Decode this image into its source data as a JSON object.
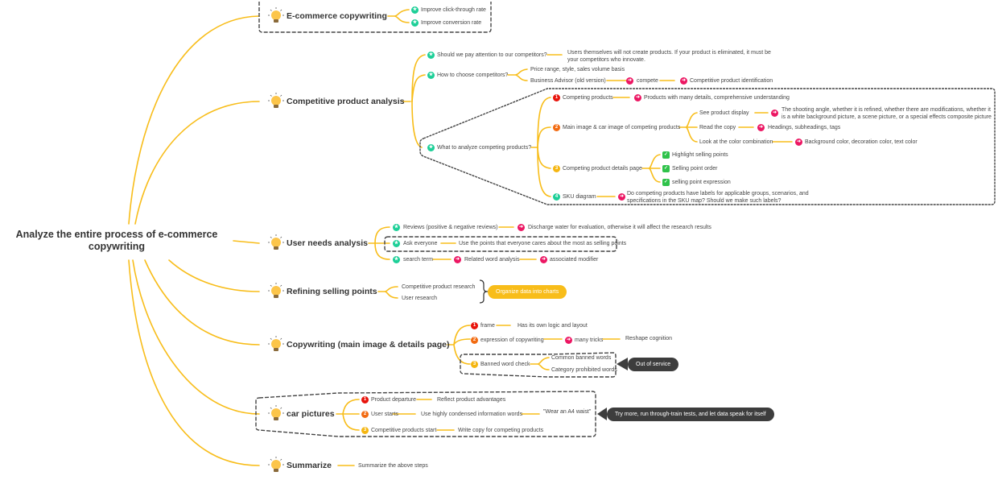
{
  "colors": {
    "branch": "#f8bd1a",
    "boundary": "#444444",
    "star_icon": "#1ccf97",
    "arrow_icon": "#ec1763",
    "priority_1": "#e8140c",
    "priority_2": "#f26b12",
    "priority_3": "#f5b611",
    "priority_4": "#1ccf97",
    "check_icon": "#2fc24a",
    "callout_dark": "#3d3d3d"
  },
  "root": {
    "title": "Analyze the entire process of e-commerce copywriting"
  },
  "topics": [
    {
      "title": "E-commerce copywriting",
      "icon": "lightbulb-icon",
      "children": [
        {
          "icon": "star-icon",
          "label": "Improve click-through rate"
        },
        {
          "icon": "star-icon",
          "label": "Improve conversion rate"
        }
      ]
    },
    {
      "title": "Competitive product analysis",
      "icon": "lightbulb-icon",
      "children": [
        {
          "icon": "star-icon",
          "label": "Should we pay attention to our competitors?",
          "children": [
            {
              "label": "Users themselves will not create products. If your product is eliminated, it must be your competitors who innovate."
            }
          ]
        },
        {
          "icon": "star-icon",
          "label": "How to choose competitors?",
          "children": [
            {
              "label": "Price range, style, sales volume basis"
            },
            {
              "label": "Business Advisor (old version)",
              "children": [
                {
                  "icon": "arrow-icon",
                  "label": "compete",
                  "children": [
                    {
                      "icon": "arrow-icon",
                      "label": "Competitive product identification"
                    }
                  ]
                }
              ]
            }
          ]
        },
        {
          "icon": "star-icon",
          "label": "What to analyze competing products?",
          "children": [
            {
              "icon": "priority-1",
              "marker": "1",
              "label": "Competing products",
              "children": [
                {
                  "icon": "arrow-icon",
                  "label": "Products with many details, comprehensive understanding"
                }
              ]
            },
            {
              "icon": "priority-2",
              "marker": "2",
              "label": "Main image & car image of competing products",
              "children": [
                {
                  "label": "See product display",
                  "children": [
                    {
                      "icon": "arrow-icon",
                      "label": "The shooting angle, whether it is refined, whether there are modifications, whether it is a white background picture, a scene picture, or a special effects composite picture"
                    }
                  ]
                },
                {
                  "label": "Read the copy",
                  "children": [
                    {
                      "icon": "arrow-icon",
                      "label": "Headings, subheadings, tags"
                    }
                  ]
                },
                {
                  "label": "Look at the color combination",
                  "children": [
                    {
                      "icon": "arrow-icon",
                      "label": "Background color, decoration color, text color"
                    }
                  ]
                }
              ]
            },
            {
              "icon": "priority-3",
              "marker": "3",
              "label": "Competing product details page",
              "children": [
                {
                  "icon": "check-icon",
                  "label": "Highlight selling points"
                },
                {
                  "icon": "check-icon",
                  "label": "Selling point order"
                },
                {
                  "icon": "check-icon",
                  "label": "selling point expression"
                }
              ]
            },
            {
              "icon": "priority-4",
              "marker": "4",
              "label": "SKU diagram",
              "children": [
                {
                  "icon": "arrow-icon",
                  "label": "Do competing products have labels for applicable groups, scenarios, and specifications in the SKU map? Should we make such labels?"
                }
              ]
            }
          ]
        }
      ]
    },
    {
      "title": "User needs analysis",
      "icon": "lightbulb-icon",
      "children": [
        {
          "icon": "star-icon",
          "label": "Reviews (positive & negative reviews)",
          "children": [
            {
              "icon": "arrow-icon",
              "label": "Discharge water for evaluation, otherwise it will affect the research results"
            }
          ]
        },
        {
          "icon": "star-icon",
          "label": "Ask everyone",
          "children": [
            {
              "label": "Use the points that everyone cares about the most as selling points"
            }
          ]
        },
        {
          "icon": "star-icon",
          "label": "search term",
          "children": [
            {
              "icon": "arrow-icon",
              "label": "Related word analysis",
              "children": [
                {
                  "icon": "arrow-icon",
                  "label": "associated modifier"
                }
              ]
            }
          ]
        }
      ]
    },
    {
      "title": "Refining selling points",
      "icon": "lightbulb-icon",
      "children": [
        {
          "label": "Competitive product research"
        },
        {
          "label": "User research"
        }
      ],
      "summary": "Organize data into charts"
    },
    {
      "title": "Copywriting (main image & details page)",
      "icon": "lightbulb-icon",
      "children": [
        {
          "icon": "priority-1",
          "marker": "1",
          "label": "frame",
          "children": [
            {
              "label": "Has its own logic and layout"
            }
          ]
        },
        {
          "icon": "priority-2",
          "marker": "2",
          "label": "expression of copywriting",
          "children": [
            {
              "icon": "arrow-icon",
              "label": "many tricks",
              "children": [
                {
                  "label": "Reshape cognition"
                }
              ]
            }
          ]
        },
        {
          "icon": "priority-3",
          "marker": "3",
          "label": "Banned word check",
          "children": [
            {
              "label": "Common banned words"
            },
            {
              "label": "Category prohibited words"
            }
          ]
        }
      ],
      "callout": "Out of service"
    },
    {
      "title": "car pictures",
      "icon": "lightbulb-icon",
      "children": [
        {
          "icon": "priority-1",
          "marker": "1",
          "label": "Product departure",
          "children": [
            {
              "label": "Reflect product advantages"
            }
          ]
        },
        {
          "icon": "priority-2",
          "marker": "2",
          "label": "User starts",
          "children": [
            {
              "label": "Use highly condensed information words",
              "children": [
                {
                  "label": "\"Wear an A4 waist\""
                }
              ]
            }
          ]
        },
        {
          "icon": "priority-3",
          "marker": "3",
          "label": "Competitive products start",
          "children": [
            {
              "label": "Write copy for competing products"
            }
          ]
        }
      ],
      "callout": "Try more, run through-train tests, and let data speak for itself"
    },
    {
      "title": "Summarize",
      "icon": "lightbulb-icon",
      "children": [
        {
          "label": "Summarize the above steps"
        }
      ]
    }
  ]
}
